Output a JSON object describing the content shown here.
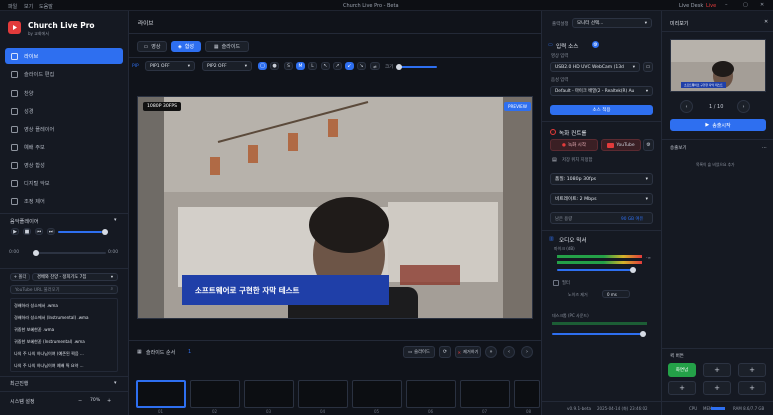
{
  "menubar": {
    "items": [
      "파일",
      "보기",
      "도움말"
    ],
    "title": "Church Live Pro - Beta",
    "status_mode": "Live Desk",
    "status_live": "Live"
  },
  "app": {
    "name": "Church Live Pro",
    "sub": "by 교회에서"
  },
  "sidebar": {
    "items": [
      {
        "label": "라이브",
        "icon": "live-icon"
      },
      {
        "label": "슬라이드 편집",
        "icon": "slides-icon"
      },
      {
        "label": "찬양",
        "icon": "music-icon"
      },
      {
        "label": "성경",
        "icon": "bible-icon"
      },
      {
        "label": "영상 플레이어",
        "icon": "video-player-icon"
      },
      {
        "label": "예배 주보",
        "icon": "bulletin-icon"
      },
      {
        "label": "영상 합성",
        "icon": "compose-icon"
      },
      {
        "label": "디지털 악보",
        "icon": "sheet-icon"
      },
      {
        "label": "조정 제어",
        "icon": "control-icon"
      }
    ],
    "music_player": {
      "title": "음악플레이어",
      "time_start": "0:00",
      "time_end": "0:00"
    },
    "playlist": {
      "add_label": "+ 폴더",
      "folder": "경배와 찬양 - 정희기도 7집",
      "url_placeholder": "YouTube URL 불러오기",
      "tracks": [
        "경배하라 성소에서 .wma",
        "경배하라 성소에서 (Instrumental) .wma",
        "귀중한 보혜한꼳 .wma",
        "귀중한 보혜한꼳 (Instrumental) .wma",
        "나의 주 나의 하나님이여 (예존된 찍음 ...",
        "나의 주 나의 하나님이여 예배 찍 요약 ..."
      ]
    },
    "recent_label": "최근진행",
    "settings_label": "시스템 설정",
    "zoom": "70%"
  },
  "center": {
    "title": "라이브",
    "tabs": [
      "영상",
      "합성",
      "슬라이드"
    ],
    "pip1": "PIP1 OFF",
    "pip2": "PIP2 OFF",
    "pip_label": "PIP",
    "sizes": [
      "S",
      "M",
      "L"
    ],
    "size_label": "크기",
    "res_badge": "1080P 30FPS",
    "preview_badge": "PREVIEW",
    "caption": "소프트웨어로 구현한 자막 테스트",
    "slide_order": "슬라이드 순서",
    "slide_count": "1",
    "btn_slide": "슬라이드",
    "btn_clear": "제거하기",
    "thumbs": [
      "01",
      "02",
      "03",
      "04",
      "05",
      "06",
      "07",
      "08"
    ]
  },
  "right": {
    "top_label": "출력설정",
    "monitor_select": "모니터 선택...",
    "input_source": "입력 소스",
    "video_input_lbl": "영상 입력",
    "video_input": "USB2.0 HD UVC WebCam (13d",
    "audio_input_lbl": "음성 입력",
    "audio_input": "Default - 마이크 배열(2 - Realtek(R) Au",
    "source_apply": "소스 적용",
    "record_control": "녹화 컨트롤",
    "rec_btn": "녹화 시작",
    "youtube_btn": "YouTube",
    "save_folder": "저장 위치 지정함",
    "quality": "품질: 1080p 30fps",
    "bitrate": "비트레이트: 2 Mbps",
    "remaining_lbl": "남은 용량",
    "remaining_val": "90 GB 여유",
    "audio_mixer": "오디오 믹서",
    "mic_label": "마이크 (dB)",
    "mic_db": "-∞",
    "filter": "필터",
    "noise": "노이즈 제거",
    "noise_val": "0 ms",
    "desktop_audio": "데스크톱 (PC 사운드)",
    "version": "v0.9.1-beta"
  },
  "farright": {
    "title": "미리보기",
    "counter": "1 / 10",
    "send_btn": "송출시작",
    "thumb_caption": "소프트웨어로 구현한 자막 테스트",
    "stream_header": "송출보기",
    "stream_hint": "목록이 슬 비었으요 추가",
    "quick_title": "퀵 버튼",
    "quick_green": "화면넘",
    "datetime": "2025-04-14 (화) 23:46:02",
    "cpu": "CPU",
    "mem": "MEM",
    "ram": "RAM 8.6/7.7 GB"
  },
  "colors": {
    "accent": "#2e6ff0",
    "live": "#e23b3b",
    "green": "#24a148"
  }
}
